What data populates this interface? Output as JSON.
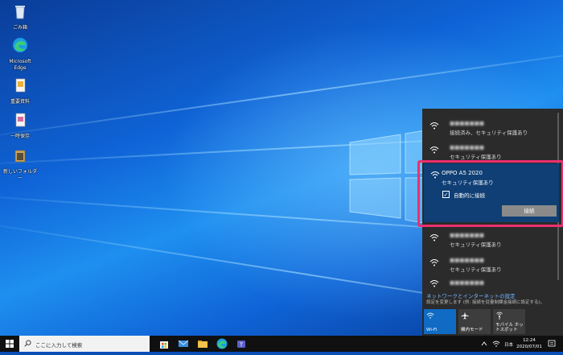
{
  "desktop": {
    "icons": [
      {
        "label": "ごみ箱",
        "icon": "recycle-bin-icon"
      },
      {
        "label": "Microsoft Edge",
        "icon": "edge-icon"
      },
      {
        "label": "重要資料",
        "icon": "document-icon"
      },
      {
        "label": "一時保存",
        "icon": "document-icon"
      },
      {
        "label": "新しいフォルダー",
        "icon": "folder-icon"
      }
    ]
  },
  "network_flyout": {
    "networks": [
      {
        "name": "■■■■■■■",
        "status": "接続済み、セキュリティ保護あり"
      },
      {
        "name": "■■■■■■■",
        "status": "セキュリティ保護あり"
      },
      {
        "name": "OPPO A5 2020",
        "status": "セキュリティ保護あり",
        "selected": true
      },
      {
        "name": "■■■■■■■",
        "status": "セキュリティ保護あり"
      },
      {
        "name": "■■■■■■■",
        "status": "セキュリティ保護あり"
      },
      {
        "name": "■■■■■■■",
        "status": ""
      }
    ],
    "auto_connect_label": "自動的に接続",
    "connect_button": "接続",
    "settings_link": "ネットワークとインターネットの設定",
    "settings_desc": "設定を変更します (例: 接続を従量制課金接続に設定する)。",
    "tiles": [
      {
        "label": "Wi-Fi",
        "active": true,
        "icon": "wifi-icon"
      },
      {
        "label": "機内モード",
        "active": false,
        "icon": "airplane-icon"
      },
      {
        "label": "モバイル ホットスポット",
        "active": false,
        "icon": "hotspot-icon"
      }
    ]
  },
  "taskbar": {
    "search_placeholder": "ここに入力して検索",
    "ime": "日本",
    "time": "12:24",
    "date": "2020/07/01"
  },
  "colors": {
    "highlight": "#ec2f6e",
    "selected_bg": "#0f3f74",
    "accent": "#0f63d6",
    "flyout_bg": "#2b2b2b"
  }
}
